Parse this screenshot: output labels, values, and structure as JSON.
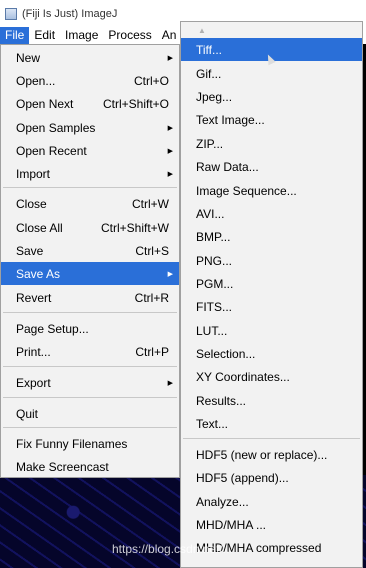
{
  "window": {
    "title": "(Fiji Is Just) ImageJ"
  },
  "menubar": {
    "file": "File",
    "edit": "Edit",
    "image": "Image",
    "process": "Process",
    "analyze": "An"
  },
  "file_menu": {
    "new": "New",
    "open": "Open...",
    "open_sc": "Ctrl+O",
    "open_next": "Open Next",
    "open_next_sc": "Ctrl+Shift+O",
    "open_samples": "Open Samples",
    "open_recent": "Open Recent",
    "import": "Import",
    "close": "Close",
    "close_sc": "Ctrl+W",
    "close_all": "Close All",
    "close_all_sc": "Ctrl+Shift+W",
    "save": "Save",
    "save_sc": "Ctrl+S",
    "save_as": "Save As",
    "revert": "Revert",
    "revert_sc": "Ctrl+R",
    "page_setup": "Page Setup...",
    "print": "Print...",
    "print_sc": "Ctrl+P",
    "export": "Export",
    "quit": "Quit",
    "fix_funny": "Fix Funny Filenames",
    "make_screencast": "Make Screencast"
  },
  "save_as_menu": {
    "items": [
      "Tiff...",
      "Gif...",
      "Jpeg...",
      "Text Image...",
      "ZIP...",
      "Raw Data...",
      "Image Sequence...",
      "AVI...",
      "BMP...",
      "PNG...",
      "PGM...",
      "FITS...",
      "LUT...",
      "Selection...",
      "XY Coordinates...",
      "Results...",
      "Text...",
      "HDF5 (new or replace)...",
      "HDF5 (append)...",
      "Analyze...",
      "MHD/MHA ...",
      "MHD/MHA compressed"
    ]
  },
  "watermark": "https://blog.csdn.net/..."
}
